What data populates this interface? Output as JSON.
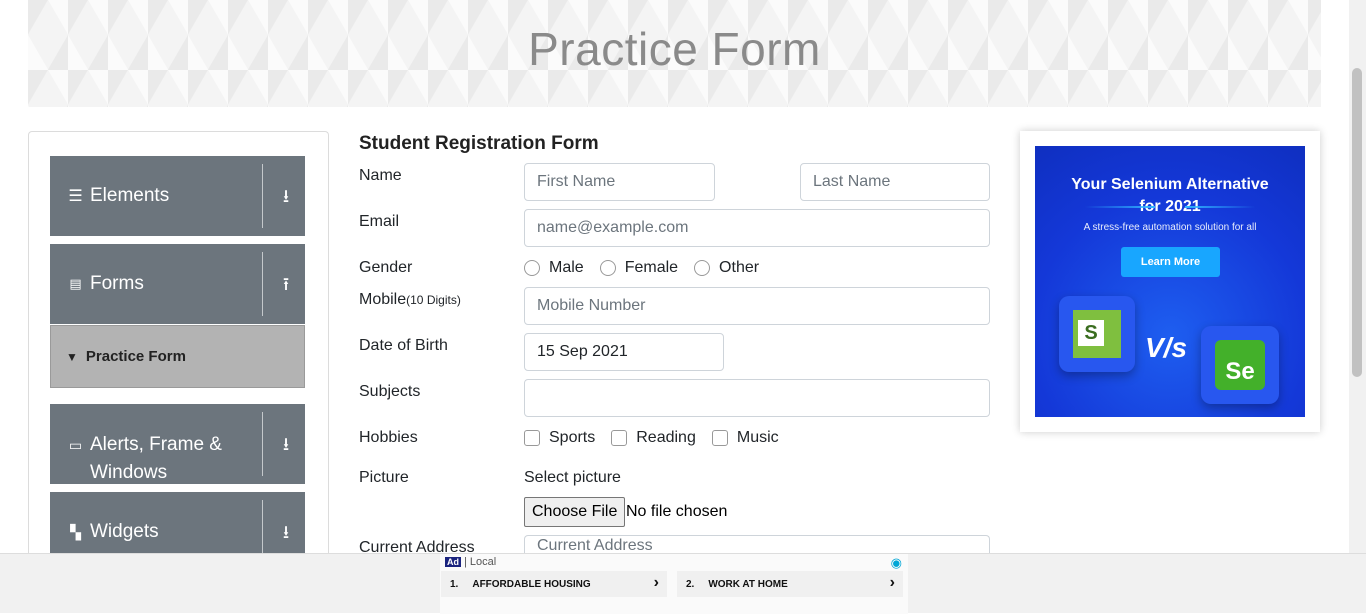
{
  "header": {
    "title": "Practice Form"
  },
  "sidebar": {
    "groups": [
      {
        "label": "Elements",
        "icon": "menu-icon",
        "arrow": "down"
      },
      {
        "label": "Forms",
        "icon": "document-icon",
        "arrow": "up"
      },
      {
        "label": "Alerts, Frame & Windows",
        "icon": "window-icon",
        "arrow": "down"
      },
      {
        "label": "Widgets",
        "icon": "widgets-icon",
        "arrow": "down"
      }
    ],
    "active_item": "Practice Form"
  },
  "form": {
    "title": "Student Registration Form",
    "name_label": "Name",
    "first_name_placeholder": "First Name",
    "last_name_placeholder": "Last Name",
    "email_label": "Email",
    "email_placeholder": "name@example.com",
    "gender_label": "Gender",
    "genders": [
      "Male",
      "Female",
      "Other"
    ],
    "mobile_label": "Mobile",
    "mobile_hint": "(10 Digits)",
    "mobile_placeholder": "Mobile Number",
    "dob_label": "Date of Birth",
    "dob_value": "15 Sep 2021",
    "subjects_label": "Subjects",
    "hobbies_label": "Hobbies",
    "hobbies": [
      "Sports",
      "Reading",
      "Music"
    ],
    "picture_label": "Picture",
    "select_picture": "Select picture",
    "choose_file": "Choose File",
    "no_file": "No file chosen",
    "address_label": "Current Address",
    "address_placeholder": "Current Address"
  },
  "ad_right": {
    "headline_1": "Your Selenium Alternative",
    "headline_2": "for 2021",
    "sub": "A stress-free automation solution for all",
    "button": "Learn More",
    "vs": "V/s",
    "logo_left": "S",
    "logo_right": "Se"
  },
  "ad_bottom": {
    "tag": "Ad",
    "local": "| Local",
    "items": [
      {
        "num": "1.",
        "label": "AFFORDABLE HOUSING"
      },
      {
        "num": "2.",
        "label": "WORK AT HOME"
      }
    ]
  }
}
